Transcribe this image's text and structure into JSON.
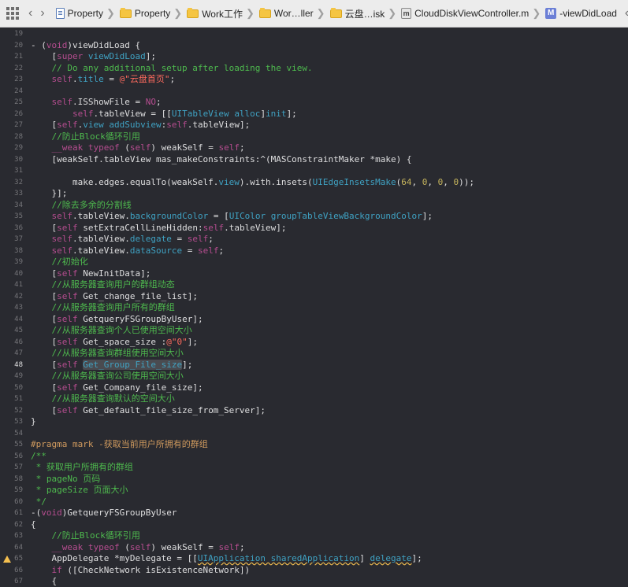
{
  "jumpbar": {
    "crumbs": [
      {
        "label": "Property",
        "icon": "project-file-icon"
      },
      {
        "label": "Property",
        "icon": "folder-icon"
      },
      {
        "label": "Work工作",
        "icon": "folder-icon"
      },
      {
        "label": "Wor…ller",
        "icon": "folder-icon"
      },
      {
        "label": "云盘…isk",
        "icon": "folder-icon"
      },
      {
        "label": "CloudDiskViewController.m",
        "icon": "m-file-icon"
      },
      {
        "label": "-viewDidLoad",
        "icon": "method-icon"
      }
    ],
    "m_letter": "m",
    "method_letter": "M"
  },
  "editor": {
    "current_line": 48,
    "warning_line": 65,
    "lines": [
      {
        "n": "19",
        "t": [
          {
            "c": "plain",
            "s": ""
          }
        ]
      },
      {
        "n": "20",
        "t": [
          {
            "c": "plain",
            "s": "- ("
          },
          {
            "c": "kw",
            "s": "void"
          },
          {
            "c": "plain",
            "s": ")viewDidLoad {"
          }
        ]
      },
      {
        "n": "21",
        "t": [
          {
            "c": "plain",
            "s": "    ["
          },
          {
            "c": "self",
            "s": "super"
          },
          {
            "c": "plain",
            "s": " "
          },
          {
            "c": "sys",
            "s": "viewDidLoad"
          },
          {
            "c": "plain",
            "s": "];"
          }
        ]
      },
      {
        "n": "22",
        "t": [
          {
            "c": "cmt",
            "s": "    // Do any additional setup after loading the view."
          }
        ]
      },
      {
        "n": "23",
        "t": [
          {
            "c": "plain",
            "s": "    "
          },
          {
            "c": "self",
            "s": "self"
          },
          {
            "c": "plain",
            "s": "."
          },
          {
            "c": "sys",
            "s": "title"
          },
          {
            "c": "plain",
            "s": " = "
          },
          {
            "c": "str",
            "s": "@\"云盘首页\""
          },
          {
            "c": "plain",
            "s": ";"
          }
        ]
      },
      {
        "n": "24",
        "t": [
          {
            "c": "plain",
            "s": ""
          }
        ]
      },
      {
        "n": "25",
        "t": [
          {
            "c": "plain",
            "s": "    "
          },
          {
            "c": "self",
            "s": "self"
          },
          {
            "c": "plain",
            "s": ".ISShowFile = "
          },
          {
            "c": "kw",
            "s": "NO"
          },
          {
            "c": "plain",
            "s": ";"
          }
        ]
      },
      {
        "n": "26",
        "t": [
          {
            "c": "plain",
            "s": "        "
          },
          {
            "c": "self",
            "s": "self"
          },
          {
            "c": "plain",
            "s": ".tableView = [["
          },
          {
            "c": "sys",
            "s": "UITableView"
          },
          {
            "c": "plain",
            "s": " "
          },
          {
            "c": "sys",
            "s": "alloc"
          },
          {
            "c": "plain",
            "s": "]"
          },
          {
            "c": "sys",
            "s": "init"
          },
          {
            "c": "plain",
            "s": "];"
          }
        ]
      },
      {
        "n": "27",
        "t": [
          {
            "c": "plain",
            "s": "    ["
          },
          {
            "c": "self",
            "s": "self"
          },
          {
            "c": "plain",
            "s": "."
          },
          {
            "c": "sys",
            "s": "view"
          },
          {
            "c": "plain",
            "s": " "
          },
          {
            "c": "sys",
            "s": "addSubview"
          },
          {
            "c": "plain",
            "s": ":"
          },
          {
            "c": "self",
            "s": "self"
          },
          {
            "c": "plain",
            "s": ".tableView];"
          }
        ]
      },
      {
        "n": "28",
        "t": [
          {
            "c": "cmt",
            "s": "    //防止Block循环引用"
          }
        ]
      },
      {
        "n": "29",
        "t": [
          {
            "c": "plain",
            "s": "    "
          },
          {
            "c": "kw",
            "s": "__weak"
          },
          {
            "c": "plain",
            "s": " "
          },
          {
            "c": "kw",
            "s": "typeof"
          },
          {
            "c": "plain",
            "s": " ("
          },
          {
            "c": "self",
            "s": "self"
          },
          {
            "c": "plain",
            "s": ") weakSelf = "
          },
          {
            "c": "self",
            "s": "self"
          },
          {
            "c": "plain",
            "s": ";"
          }
        ]
      },
      {
        "n": "30",
        "t": [
          {
            "c": "plain",
            "s": "    [weakSelf.tableView mas_makeConstraints:^(MASConstraintMaker *make) {"
          }
        ]
      },
      {
        "n": "31",
        "t": [
          {
            "c": "plain",
            "s": ""
          }
        ]
      },
      {
        "n": "32",
        "t": [
          {
            "c": "plain",
            "s": "        make.edges.equalTo(weakSelf."
          },
          {
            "c": "sys",
            "s": "view"
          },
          {
            "c": "plain",
            "s": ").with.insets("
          },
          {
            "c": "sys",
            "s": "UIEdgeInsetsMake"
          },
          {
            "c": "plain",
            "s": "("
          },
          {
            "c": "num",
            "s": "64"
          },
          {
            "c": "plain",
            "s": ", "
          },
          {
            "c": "num",
            "s": "0"
          },
          {
            "c": "plain",
            "s": ", "
          },
          {
            "c": "num",
            "s": "0"
          },
          {
            "c": "plain",
            "s": ", "
          },
          {
            "c": "num",
            "s": "0"
          },
          {
            "c": "plain",
            "s": "));"
          }
        ]
      },
      {
        "n": "33",
        "t": [
          {
            "c": "plain",
            "s": "    }];"
          }
        ]
      },
      {
        "n": "34",
        "t": [
          {
            "c": "cmt",
            "s": "    //除去多余的分割线"
          }
        ]
      },
      {
        "n": "35",
        "t": [
          {
            "c": "plain",
            "s": "    "
          },
          {
            "c": "self",
            "s": "self"
          },
          {
            "c": "plain",
            "s": ".tableView."
          },
          {
            "c": "sys",
            "s": "backgroundColor"
          },
          {
            "c": "plain",
            "s": " = ["
          },
          {
            "c": "sys",
            "s": "UIColor"
          },
          {
            "c": "plain",
            "s": " "
          },
          {
            "c": "sys",
            "s": "groupTableViewBackgroundColor"
          },
          {
            "c": "plain",
            "s": "];"
          }
        ]
      },
      {
        "n": "36",
        "t": [
          {
            "c": "plain",
            "s": "    ["
          },
          {
            "c": "self",
            "s": "self"
          },
          {
            "c": "plain",
            "s": " setExtraCellLineHidden:"
          },
          {
            "c": "self",
            "s": "self"
          },
          {
            "c": "plain",
            "s": ".tableView];"
          }
        ]
      },
      {
        "n": "37",
        "t": [
          {
            "c": "plain",
            "s": "    "
          },
          {
            "c": "self",
            "s": "self"
          },
          {
            "c": "plain",
            "s": ".tableView."
          },
          {
            "c": "sys",
            "s": "delegate"
          },
          {
            "c": "plain",
            "s": " = "
          },
          {
            "c": "self",
            "s": "self"
          },
          {
            "c": "plain",
            "s": ";"
          }
        ]
      },
      {
        "n": "38",
        "t": [
          {
            "c": "plain",
            "s": "    "
          },
          {
            "c": "self",
            "s": "self"
          },
          {
            "c": "plain",
            "s": ".tableView."
          },
          {
            "c": "sys",
            "s": "dataSource"
          },
          {
            "c": "plain",
            "s": " = "
          },
          {
            "c": "self",
            "s": "self"
          },
          {
            "c": "plain",
            "s": ";"
          }
        ]
      },
      {
        "n": "39",
        "t": [
          {
            "c": "cmt",
            "s": "    //初始化"
          }
        ]
      },
      {
        "n": "40",
        "t": [
          {
            "c": "plain",
            "s": "    ["
          },
          {
            "c": "self",
            "s": "self"
          },
          {
            "c": "plain",
            "s": " NewInitData];"
          }
        ]
      },
      {
        "n": "41",
        "t": [
          {
            "c": "cmt",
            "s": "    //从服务器查询用户的群组动态"
          }
        ]
      },
      {
        "n": "42",
        "t": [
          {
            "c": "plain",
            "s": "    ["
          },
          {
            "c": "self",
            "s": "self"
          },
          {
            "c": "plain",
            "s": " Get_change_file_list];"
          }
        ]
      },
      {
        "n": "43",
        "t": [
          {
            "c": "cmt",
            "s": "    //从服务器查询用户所有的群组"
          }
        ]
      },
      {
        "n": "44",
        "t": [
          {
            "c": "plain",
            "s": "    ["
          },
          {
            "c": "self",
            "s": "self"
          },
          {
            "c": "plain",
            "s": " GetqueryFSGroupByUser];"
          }
        ]
      },
      {
        "n": "45",
        "t": [
          {
            "c": "cmt",
            "s": "    //从服务器查询个人已使用空间大小"
          }
        ]
      },
      {
        "n": "46",
        "t": [
          {
            "c": "plain",
            "s": "    ["
          },
          {
            "c": "self",
            "s": "self"
          },
          {
            "c": "plain",
            "s": " Get_space_size :"
          },
          {
            "c": "str",
            "s": "@\"0\""
          },
          {
            "c": "plain",
            "s": "];"
          }
        ]
      },
      {
        "n": "47",
        "t": [
          {
            "c": "cmt",
            "s": "    //从服务器查询群组使用空间大小"
          }
        ]
      },
      {
        "n": "48",
        "t": [
          {
            "c": "plain",
            "s": "    ["
          },
          {
            "c": "self",
            "s": "self"
          },
          {
            "c": "plain",
            "s": " "
          },
          {
            "c": "hl",
            "s": "Get_Group_File_size"
          },
          {
            "c": "plain",
            "s": "];"
          }
        ]
      },
      {
        "n": "49",
        "t": [
          {
            "c": "cmt",
            "s": "    //从服务器查询公司使用空间大小"
          }
        ]
      },
      {
        "n": "50",
        "t": [
          {
            "c": "plain",
            "s": "    ["
          },
          {
            "c": "self",
            "s": "self"
          },
          {
            "c": "plain",
            "s": " Get_Company_file_size];"
          }
        ]
      },
      {
        "n": "51",
        "t": [
          {
            "c": "cmt",
            "s": "    //从服务器查询默认的空间大小"
          }
        ]
      },
      {
        "n": "52",
        "t": [
          {
            "c": "plain",
            "s": "    ["
          },
          {
            "c": "self",
            "s": "self"
          },
          {
            "c": "plain",
            "s": " Get_default_file_size_from_Server];"
          }
        ]
      },
      {
        "n": "53",
        "t": [
          {
            "c": "plain",
            "s": "}"
          }
        ]
      },
      {
        "n": "54",
        "t": [
          {
            "c": "plain",
            "s": ""
          }
        ]
      },
      {
        "n": "55",
        "t": [
          {
            "c": "mark",
            "s": "#pragma mark -获取当前用户所拥有的群组"
          }
        ]
      },
      {
        "n": "56",
        "t": [
          {
            "c": "doc",
            "s": "/**"
          }
        ]
      },
      {
        "n": "57",
        "t": [
          {
            "c": "doc",
            "s": " * 获取用户所拥有的群组"
          }
        ]
      },
      {
        "n": "58",
        "t": [
          {
            "c": "doc",
            "s": " * pageNo 页码"
          }
        ]
      },
      {
        "n": "59",
        "t": [
          {
            "c": "doc",
            "s": " * pageSize 页面大小"
          }
        ]
      },
      {
        "n": "60",
        "t": [
          {
            "c": "doc",
            "s": " */"
          }
        ]
      },
      {
        "n": "61",
        "t": [
          {
            "c": "plain",
            "s": "-("
          },
          {
            "c": "kw",
            "s": "void"
          },
          {
            "c": "plain",
            "s": ")GetqueryFSGroupByUser"
          }
        ]
      },
      {
        "n": "62",
        "t": [
          {
            "c": "plain",
            "s": "{"
          }
        ]
      },
      {
        "n": "63",
        "t": [
          {
            "c": "cmt",
            "s": "    //防止Block循环引用"
          }
        ]
      },
      {
        "n": "64",
        "t": [
          {
            "c": "plain",
            "s": "    "
          },
          {
            "c": "kw",
            "s": "__weak"
          },
          {
            "c": "plain",
            "s": " "
          },
          {
            "c": "kw",
            "s": "typeof"
          },
          {
            "c": "plain",
            "s": " ("
          },
          {
            "c": "self",
            "s": "self"
          },
          {
            "c": "plain",
            "s": ") weakSelf = "
          },
          {
            "c": "self",
            "s": "self"
          },
          {
            "c": "plain",
            "s": ";"
          }
        ]
      },
      {
        "n": "65",
        "t": [
          {
            "c": "plain",
            "s": "    AppDelegate *myDelegate = [["
          },
          {
            "c": "warn",
            "s": "UIApplication sharedApplication"
          },
          {
            "c": "plain",
            "s": "] "
          },
          {
            "c": "warn",
            "s": "delegate"
          },
          {
            "c": "plain",
            "s": "];"
          }
        ]
      },
      {
        "n": "66",
        "t": [
          {
            "c": "plain",
            "s": "    "
          },
          {
            "c": "kw",
            "s": "if"
          },
          {
            "c": "plain",
            "s": " ([CheckNetwork isExistenceNetwork])"
          }
        ]
      },
      {
        "n": "67",
        "t": [
          {
            "c": "plain",
            "s": "    {"
          }
        ]
      }
    ]
  }
}
